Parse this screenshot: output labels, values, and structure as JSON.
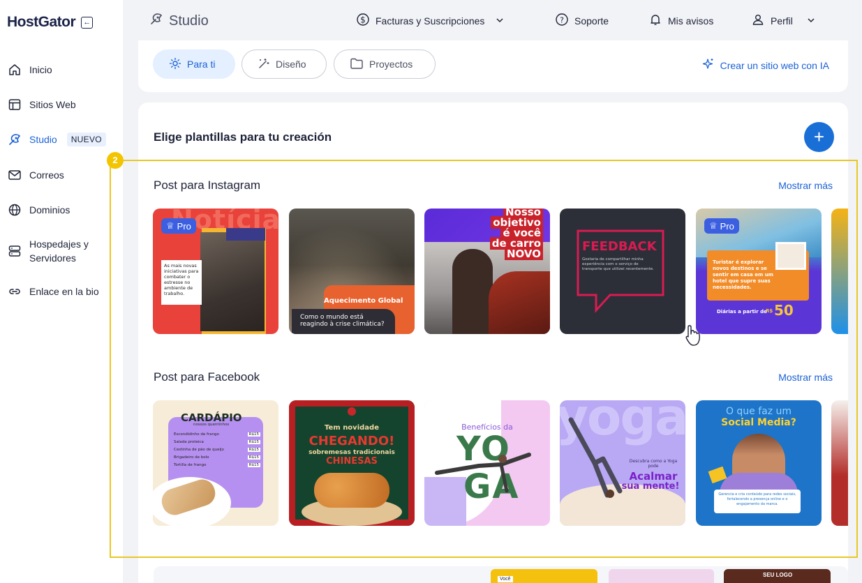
{
  "sidebar": {
    "logo": "HostGator",
    "items": [
      {
        "label": "Inicio",
        "icon": "home-icon"
      },
      {
        "label": "Sitios Web",
        "icon": "layout-icon"
      },
      {
        "label": "Studio",
        "icon": "studio-icon",
        "badge": "NUEVO",
        "active": true
      },
      {
        "label": "Correos",
        "icon": "mail-icon"
      },
      {
        "label": "Dominios",
        "icon": "globe-icon"
      },
      {
        "label": "Hospedajes y Servidores",
        "line1": "Hospedajes y",
        "line2": "Servidores",
        "icon": "server-icon"
      },
      {
        "label": "Enlace en la bio",
        "icon": "link-icon"
      }
    ]
  },
  "header": {
    "title": "Studio",
    "billing": "Facturas y Suscripciones",
    "support": "Soporte",
    "notices": "Mis avisos",
    "profile": "Perfil"
  },
  "tabs": [
    {
      "label": "Para ti",
      "active": true
    },
    {
      "label": "Diseño"
    },
    {
      "label": "Proyectos"
    }
  ],
  "ai_link": "Crear un sitio web con IA",
  "main": {
    "title": "Elige plantillas para tu creación",
    "add_label": "+",
    "step": "2",
    "instagram": {
      "title": "Post para Instagram",
      "more": "Mostrar más",
      "pro": "Pro",
      "t1": {
        "headline": "Notícia",
        "text": "As mais novas iniciativas para combater o estresse no ambiente de trabalho."
      },
      "t2": {
        "tag": "Aquecimento Global",
        "text": "Como o mundo está reagindo à crise climática?"
      },
      "t3": {
        "line1": "Nosso",
        "line2": "objetivo",
        "line3": "é você",
        "line4": "de carro",
        "line5": "NOVO"
      },
      "t4": {
        "headline": "FEEDBACK",
        "text": "Gostaria de compartilhar minha experiência com o serviço de transporte que utilizei recentemente."
      },
      "t5": {
        "text": "Turistar é explorar novos destinos e se sentir em casa em um hotel que supre suas necessidades.",
        "price_label": "Diárias a partir de",
        "currency": "R$",
        "price": "50"
      }
    },
    "facebook": {
      "title": "Post para Facebook",
      "more": "Mostrar más",
      "t1": {
        "headline": "CARDÁPIO",
        "sub": "nossos quentinhos",
        "items": [
          "Escondidinho de frango",
          "Salada proteica",
          "Cestinha de pão de queijo",
          "Brigadeiro de bolo",
          "Tortilla de frango"
        ],
        "price": "R$15"
      },
      "t2": {
        "line1": "Tem novidade",
        "line2": "CHEGANDO!",
        "line3": "sobremesas tradicionais",
        "line4": "CHINESAS"
      },
      "t3": {
        "line1": "Benefícios da",
        "line2": "YO",
        "line3": "GA"
      },
      "t4": {
        "bg": "yoga",
        "line1": "Descubra como a Yoga pode",
        "line2": "Acalmar",
        "line3": "sua mente!"
      },
      "t5": {
        "line1": "O que faz um",
        "line2": "Social Media?",
        "text": "Gerencia e cria conteúdo para redes sociais, fortalecendo a presença online e o engajamento da marca."
      }
    },
    "bottom": {
      "logo_text": "SEU LOGO",
      "promo": "Você"
    }
  },
  "colors": {
    "accent": "#1a61d6",
    "highlight": "#e8c724",
    "badge_bg": "#e8f0fd"
  }
}
